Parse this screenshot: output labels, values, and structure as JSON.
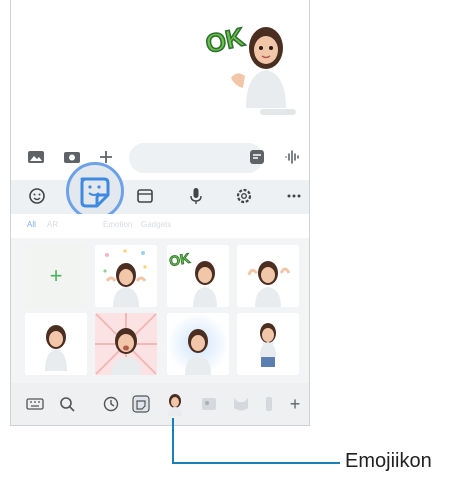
{
  "chat": {
    "sticker_text": "OK"
  },
  "tabs": [
    {
      "label": "All"
    },
    {
      "label": "AR"
    },
    {
      "label": "Emotion"
    },
    {
      "label": "Gadgets"
    }
  ],
  "colors": {
    "accent": "#6da1e8",
    "add_plus": "#4bb25d",
    "callout_line": "#1a7fb8"
  },
  "icons": {
    "input_bar": [
      "image-icon",
      "camera-icon",
      "plus-icon",
      "sticker-field-icon",
      "voice-icon"
    ],
    "toolbar": [
      "emoji-icon",
      "sticker-icon",
      "gif-icon",
      "mic-icon",
      "settings-icon",
      "more-icon"
    ],
    "bottom_bar": [
      "keyboard-icon",
      "search-icon",
      "recent-icon",
      "sticker-tab-icon",
      "ar-emoji-icon",
      "pack-icon-1",
      "pack-icon-2",
      "pack-icon-3",
      "add-icon"
    ]
  },
  "callout": {
    "label": "Emojiikon"
  }
}
